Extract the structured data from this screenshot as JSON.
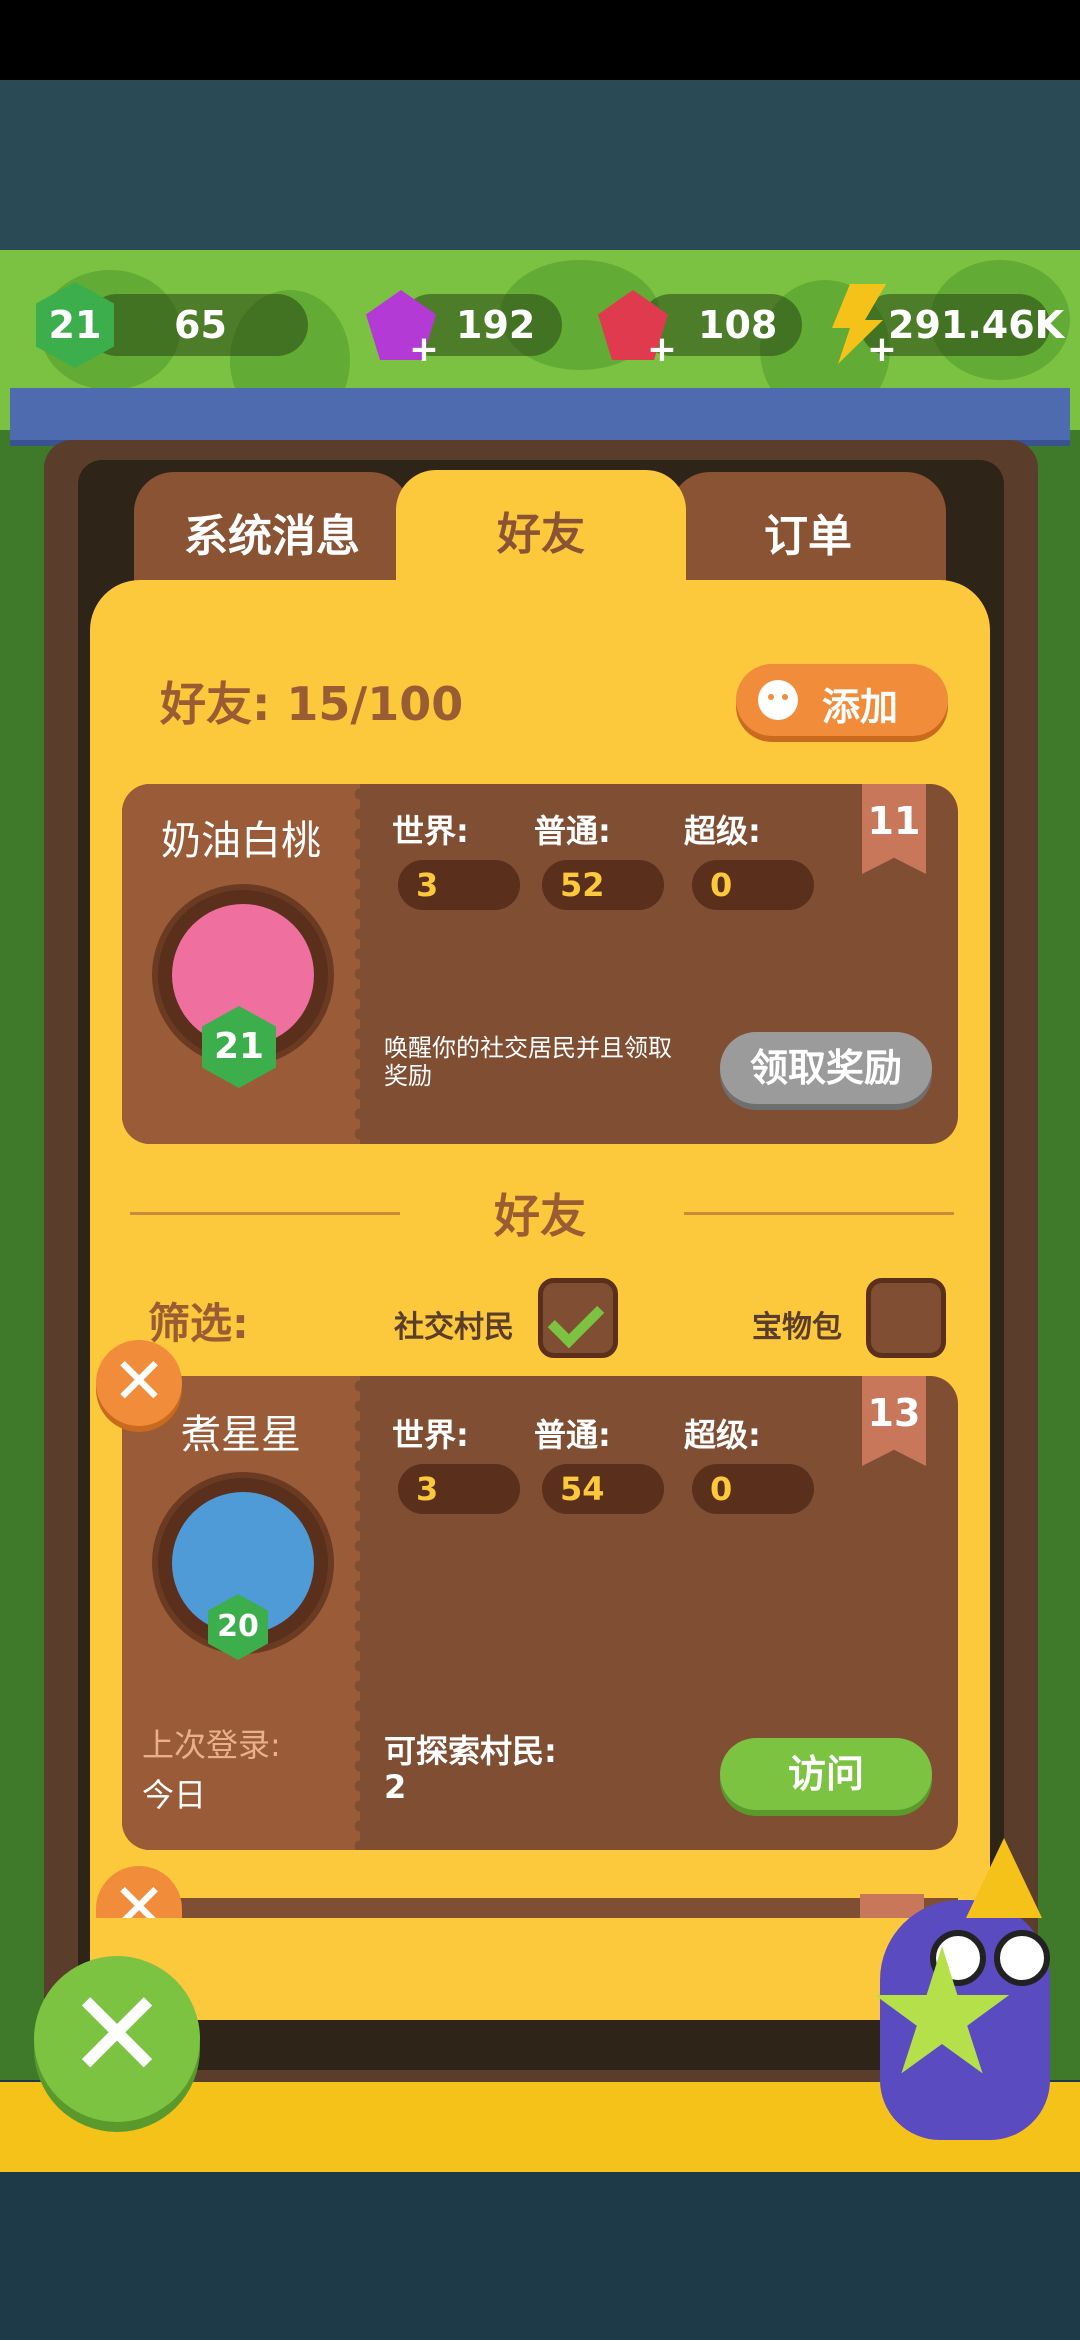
{
  "currency": {
    "level": "21",
    "xp": "65",
    "purple_gems": "192",
    "red_gems": "108",
    "energy": "291.46K"
  },
  "tabs": [
    {
      "label": "系统消息",
      "active": false
    },
    {
      "label": "好友",
      "active": true
    },
    {
      "label": "订单",
      "active": false
    }
  ],
  "friends_header": {
    "count_text": "好友: 15/100",
    "add_label": "添加"
  },
  "self_card": {
    "name": "奶油白桃",
    "level": "21",
    "rank": "11",
    "world_label": "世界:",
    "normal_label": "普通:",
    "super_label": "超级:",
    "world": "3",
    "normal": "52",
    "super": "0",
    "message": "唤醒你的社交居民并且领取奖励",
    "claim_label": "领取奖励"
  },
  "friends_section": {
    "title": "好友",
    "filter_label": "筛选:",
    "filter_social": "社交村民",
    "filter_social_checked": true,
    "filter_treasure": "宝物包",
    "filter_treasure_checked": false
  },
  "friend_card": {
    "name": "煮星星",
    "level": "20",
    "rank": "13",
    "world_label": "世界:",
    "normal_label": "普通:",
    "super_label": "超级:",
    "world": "3",
    "normal": "54",
    "super": "0",
    "last_login_label": "上次登录:",
    "last_login": "今日",
    "explorable_label": "可探索村民:",
    "explorable": "2",
    "visit_label": "访问"
  },
  "colors": {
    "panel": "#fbc93b",
    "card": "#804e33",
    "accent_orange": "#f08c3a",
    "accent_green": "#7cc342"
  }
}
